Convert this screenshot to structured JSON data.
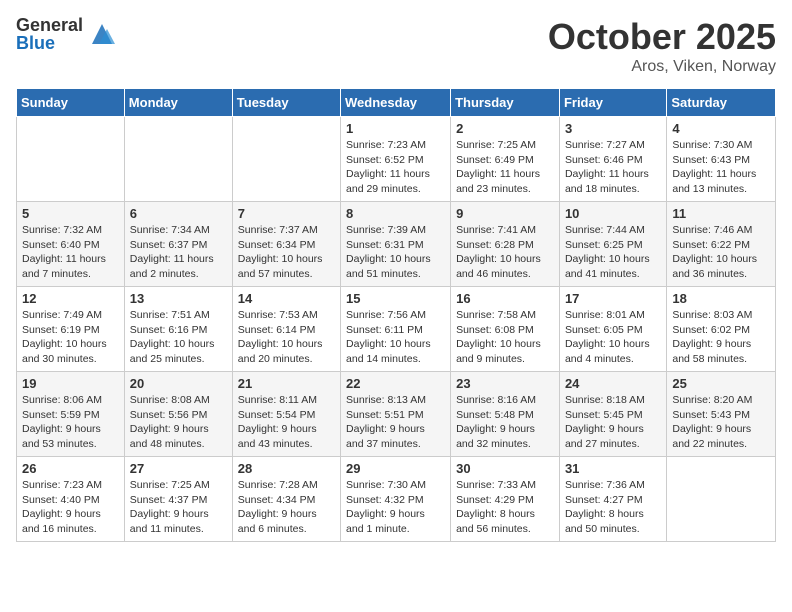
{
  "header": {
    "logo_general": "General",
    "logo_blue": "Blue",
    "month_title": "October 2025",
    "location": "Aros, Viken, Norway"
  },
  "weekdays": [
    "Sunday",
    "Monday",
    "Tuesday",
    "Wednesday",
    "Thursday",
    "Friday",
    "Saturday"
  ],
  "weeks": [
    [
      {
        "day": "",
        "info": ""
      },
      {
        "day": "",
        "info": ""
      },
      {
        "day": "",
        "info": ""
      },
      {
        "day": "1",
        "info": "Sunrise: 7:23 AM\nSunset: 6:52 PM\nDaylight: 11 hours\nand 29 minutes."
      },
      {
        "day": "2",
        "info": "Sunrise: 7:25 AM\nSunset: 6:49 PM\nDaylight: 11 hours\nand 23 minutes."
      },
      {
        "day": "3",
        "info": "Sunrise: 7:27 AM\nSunset: 6:46 PM\nDaylight: 11 hours\nand 18 minutes."
      },
      {
        "day": "4",
        "info": "Sunrise: 7:30 AM\nSunset: 6:43 PM\nDaylight: 11 hours\nand 13 minutes."
      }
    ],
    [
      {
        "day": "5",
        "info": "Sunrise: 7:32 AM\nSunset: 6:40 PM\nDaylight: 11 hours\nand 7 minutes."
      },
      {
        "day": "6",
        "info": "Sunrise: 7:34 AM\nSunset: 6:37 PM\nDaylight: 11 hours\nand 2 minutes."
      },
      {
        "day": "7",
        "info": "Sunrise: 7:37 AM\nSunset: 6:34 PM\nDaylight: 10 hours\nand 57 minutes."
      },
      {
        "day": "8",
        "info": "Sunrise: 7:39 AM\nSunset: 6:31 PM\nDaylight: 10 hours\nand 51 minutes."
      },
      {
        "day": "9",
        "info": "Sunrise: 7:41 AM\nSunset: 6:28 PM\nDaylight: 10 hours\nand 46 minutes."
      },
      {
        "day": "10",
        "info": "Sunrise: 7:44 AM\nSunset: 6:25 PM\nDaylight: 10 hours\nand 41 minutes."
      },
      {
        "day": "11",
        "info": "Sunrise: 7:46 AM\nSunset: 6:22 PM\nDaylight: 10 hours\nand 36 minutes."
      }
    ],
    [
      {
        "day": "12",
        "info": "Sunrise: 7:49 AM\nSunset: 6:19 PM\nDaylight: 10 hours\nand 30 minutes."
      },
      {
        "day": "13",
        "info": "Sunrise: 7:51 AM\nSunset: 6:16 PM\nDaylight: 10 hours\nand 25 minutes."
      },
      {
        "day": "14",
        "info": "Sunrise: 7:53 AM\nSunset: 6:14 PM\nDaylight: 10 hours\nand 20 minutes."
      },
      {
        "day": "15",
        "info": "Sunrise: 7:56 AM\nSunset: 6:11 PM\nDaylight: 10 hours\nand 14 minutes."
      },
      {
        "day": "16",
        "info": "Sunrise: 7:58 AM\nSunset: 6:08 PM\nDaylight: 10 hours\nand 9 minutes."
      },
      {
        "day": "17",
        "info": "Sunrise: 8:01 AM\nSunset: 6:05 PM\nDaylight: 10 hours\nand 4 minutes."
      },
      {
        "day": "18",
        "info": "Sunrise: 8:03 AM\nSunset: 6:02 PM\nDaylight: 9 hours\nand 58 minutes."
      }
    ],
    [
      {
        "day": "19",
        "info": "Sunrise: 8:06 AM\nSunset: 5:59 PM\nDaylight: 9 hours\nand 53 minutes."
      },
      {
        "day": "20",
        "info": "Sunrise: 8:08 AM\nSunset: 5:56 PM\nDaylight: 9 hours\nand 48 minutes."
      },
      {
        "day": "21",
        "info": "Sunrise: 8:11 AM\nSunset: 5:54 PM\nDaylight: 9 hours\nand 43 minutes."
      },
      {
        "day": "22",
        "info": "Sunrise: 8:13 AM\nSunset: 5:51 PM\nDaylight: 9 hours\nand 37 minutes."
      },
      {
        "day": "23",
        "info": "Sunrise: 8:16 AM\nSunset: 5:48 PM\nDaylight: 9 hours\nand 32 minutes."
      },
      {
        "day": "24",
        "info": "Sunrise: 8:18 AM\nSunset: 5:45 PM\nDaylight: 9 hours\nand 27 minutes."
      },
      {
        "day": "25",
        "info": "Sunrise: 8:20 AM\nSunset: 5:43 PM\nDaylight: 9 hours\nand 22 minutes."
      }
    ],
    [
      {
        "day": "26",
        "info": "Sunrise: 7:23 AM\nSunset: 4:40 PM\nDaylight: 9 hours\nand 16 minutes."
      },
      {
        "day": "27",
        "info": "Sunrise: 7:25 AM\nSunset: 4:37 PM\nDaylight: 9 hours\nand 11 minutes."
      },
      {
        "day": "28",
        "info": "Sunrise: 7:28 AM\nSunset: 4:34 PM\nDaylight: 9 hours\nand 6 minutes."
      },
      {
        "day": "29",
        "info": "Sunrise: 7:30 AM\nSunset: 4:32 PM\nDaylight: 9 hours\nand 1 minute."
      },
      {
        "day": "30",
        "info": "Sunrise: 7:33 AM\nSunset: 4:29 PM\nDaylight: 8 hours\nand 56 minutes."
      },
      {
        "day": "31",
        "info": "Sunrise: 7:36 AM\nSunset: 4:27 PM\nDaylight: 8 hours\nand 50 minutes."
      },
      {
        "day": "",
        "info": ""
      }
    ]
  ]
}
